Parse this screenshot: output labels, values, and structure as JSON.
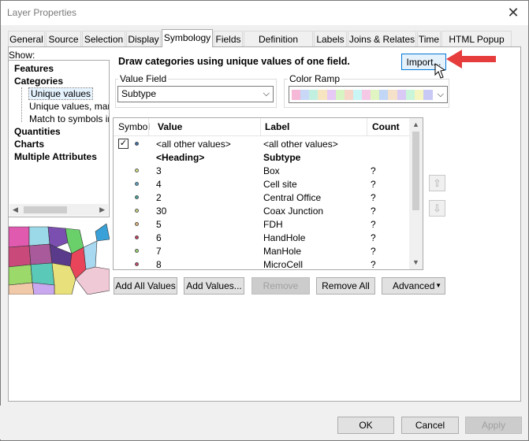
{
  "window": {
    "title": "Layer Properties",
    "close_glyph": "✕"
  },
  "tabs": [
    {
      "label": "General"
    },
    {
      "label": "Source"
    },
    {
      "label": "Selection"
    },
    {
      "label": "Display"
    },
    {
      "label": "Symbology"
    },
    {
      "label": "Fields"
    },
    {
      "label": "Definition Query"
    },
    {
      "label": "Labels"
    },
    {
      "label": "Joins & Relates"
    },
    {
      "label": "Time"
    },
    {
      "label": "HTML Popup"
    }
  ],
  "active_tab": "Symbology",
  "show": {
    "label": "Show:",
    "items": [
      {
        "label": "Features"
      },
      {
        "label": "Categories"
      },
      {
        "label": "Unique values"
      },
      {
        "label": "Unique values, many"
      },
      {
        "label": "Match to symbols in a"
      },
      {
        "label": "Quantities"
      },
      {
        "label": "Charts"
      },
      {
        "label": "Multiple Attributes"
      }
    ],
    "selected": "Unique values"
  },
  "description": "Draw categories using unique values of one field.",
  "import_label": "Import...",
  "value_field": {
    "label": "Value Field",
    "value": "Subtype"
  },
  "color_ramp": {
    "label": "Color Ramp",
    "colors": [
      "#f5b8d6",
      "#c9d8f7",
      "#c2f0e0",
      "#f7e5c2",
      "#e6c9f5",
      "#d6f5c2",
      "#f5d6c9",
      "#c9f5f5",
      "#f5c9e6",
      "#e0f5c2",
      "#c2d6f5",
      "#f5e0c9",
      "#d9c9f5",
      "#c9f5d9",
      "#f5f5c2",
      "#c9c9f5"
    ]
  },
  "table": {
    "headers": {
      "symbol": "Symbol",
      "value": "Value",
      "label": "Label",
      "count": "Count"
    },
    "rows": [
      {
        "value": "<all other values>",
        "label": "<all other values>",
        "count": "",
        "checked": true,
        "dot": "#3a6ea5",
        "bold": false,
        "dot_visible": true
      },
      {
        "value": "<Heading>",
        "label": "Subtype",
        "count": "",
        "checked": false,
        "dot": "",
        "bold": true,
        "dot_visible": false
      },
      {
        "value": "3",
        "label": "Box",
        "count": "?",
        "checked": false,
        "dot": "#d8e87a",
        "bold": false,
        "dot_visible": true
      },
      {
        "value": "4",
        "label": "Cell site",
        "count": "?",
        "checked": false,
        "dot": "#5aa3c9",
        "bold": false,
        "dot_visible": true
      },
      {
        "value": "2",
        "label": "Central Office",
        "count": "?",
        "checked": false,
        "dot": "#3fa89a",
        "bold": false,
        "dot_visible": true
      },
      {
        "value": "30",
        "label": "Coax Junction",
        "count": "?",
        "checked": false,
        "dot": "#c9d97a",
        "bold": false,
        "dot_visible": true
      },
      {
        "value": "5",
        "label": "FDH",
        "count": "?",
        "checked": false,
        "dot": "#e8b87a",
        "bold": false,
        "dot_visible": true
      },
      {
        "value": "6",
        "label": "HandHole",
        "count": "?",
        "checked": false,
        "dot": "#c93a5a",
        "bold": false,
        "dot_visible": true
      },
      {
        "value": "7",
        "label": "ManHole",
        "count": "?",
        "checked": false,
        "dot": "#9ad96a",
        "bold": false,
        "dot_visible": true
      },
      {
        "value": "8",
        "label": "MicroCell",
        "count": "?",
        "checked": false,
        "dot": "#c94a6a",
        "bold": false,
        "dot_visible": true
      }
    ]
  },
  "buttons": {
    "add_all": "Add All Values",
    "add_values": "Add Values...",
    "remove": "Remove",
    "remove_all": "Remove All",
    "advanced": "Advanced",
    "ok": "OK",
    "cancel": "Cancel",
    "apply": "Apply"
  },
  "colors": {
    "accent": "#0078d7",
    "callout_arrow": "#e63c3c"
  }
}
